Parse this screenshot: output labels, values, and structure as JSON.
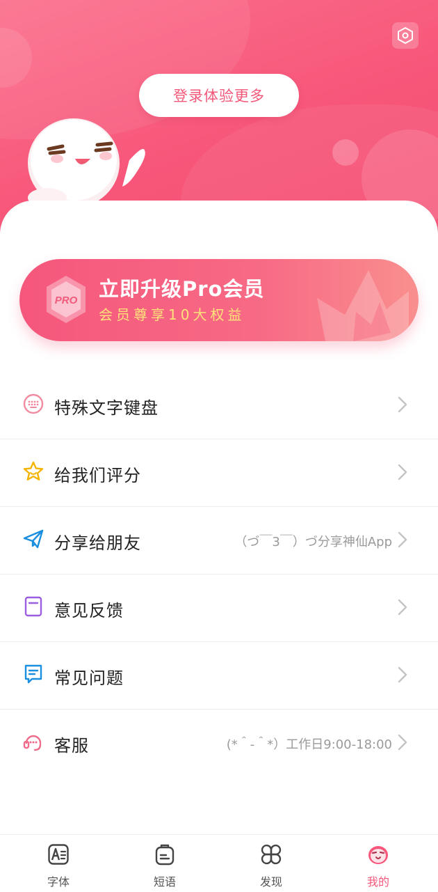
{
  "header": {
    "login_label": "登录体验更多",
    "accent_color": "#f7577a",
    "settings_icon": "hexagon-settings-icon"
  },
  "pro_banner": {
    "badge_text": "PRO",
    "title": "立即升级Pro会员",
    "subtitle": "会员尊享10大权益"
  },
  "menu": {
    "items": [
      {
        "label": "特殊文字键盘",
        "hint": "",
        "icon": "keyboard-icon"
      },
      {
        "label": "给我们评分",
        "hint": "",
        "icon": "star-icon"
      },
      {
        "label": "分享给朋友",
        "hint": "（づ￣3￣）づ分享神仙App",
        "icon": "paper-plane-icon"
      },
      {
        "label": "意见反馈",
        "hint": "",
        "icon": "feedback-doc-icon"
      },
      {
        "label": "常见问题",
        "hint": "",
        "icon": "faq-chat-icon"
      },
      {
        "label": "客服",
        "hint": "(*＾-＾*）工作日9:00-18:00",
        "icon": "headset-icon"
      }
    ]
  },
  "tabbar": {
    "tabs": [
      {
        "label": "字体",
        "icon": "font-icon",
        "active": false
      },
      {
        "label": "短语",
        "icon": "phrase-icon",
        "active": false
      },
      {
        "label": "发现",
        "icon": "discover-icon",
        "active": false
      },
      {
        "label": "我的",
        "icon": "profile-avatar-icon",
        "active": true
      }
    ]
  }
}
